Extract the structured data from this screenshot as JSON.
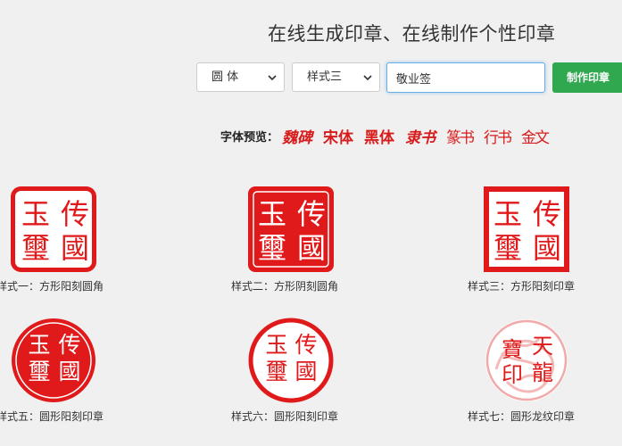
{
  "header": {
    "title": "在线生成印章、在线制作个性印章"
  },
  "form": {
    "font_select": "圆 体",
    "style_select": "样式三",
    "text_value": "敬业签",
    "make_button": "制作印章"
  },
  "font_preview": {
    "label": "字体预览：",
    "samples": [
      "魏碑",
      "宋体",
      "黑体",
      "隶书",
      "篆书",
      "行书",
      "金文"
    ]
  },
  "colors": {
    "seal_red": "#e01a1a",
    "button_green": "#2fa84f",
    "input_focus": "#66afe9"
  },
  "seals": [
    {
      "caption": "样式一：方形阳刻圆角",
      "chars": [
        "传",
        "玉",
        "國",
        "璽"
      ]
    },
    {
      "caption": "样式二：方形阴刻圆角",
      "chars": [
        "传",
        "玉",
        "國",
        "璽"
      ]
    },
    {
      "caption": "样式三：方形阳刻印章",
      "chars": [
        "传",
        "玉",
        "國",
        "璽"
      ]
    },
    {
      "caption": "样式五：圆形阳刻印章",
      "chars": [
        "传",
        "玉",
        "國",
        "璽"
      ]
    },
    {
      "caption": "样式六：圆形阳刻印章",
      "chars": [
        "传",
        "玉",
        "國",
        "璽"
      ]
    },
    {
      "caption": "样式七：圆形龙纹印章",
      "chars": [
        "天",
        "寶",
        "龍",
        "印"
      ]
    }
  ]
}
